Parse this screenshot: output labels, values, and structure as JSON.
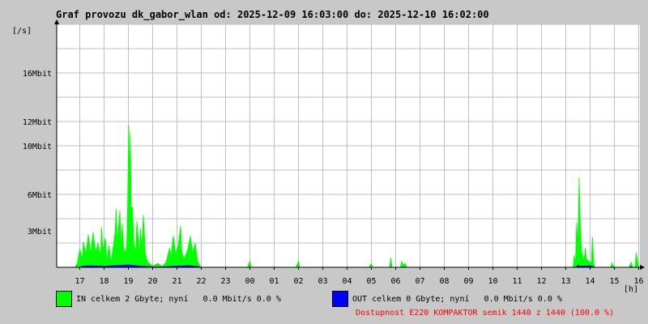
{
  "chart_data": {
    "type": "area",
    "title": "Graf provozu dk_gabor_wlan od: 2025-12-09 16:03:00 do: 2025-12-10 16:02:00",
    "ylabel": "[/s]",
    "xlabel": "[h]",
    "x_ticks": [
      "17",
      "18",
      "19",
      "20",
      "21",
      "22",
      "23",
      "00",
      "01",
      "02",
      "03",
      "04",
      "05",
      "06",
      "07",
      "08",
      "09",
      "10",
      "11",
      "12",
      "13",
      "14",
      "15",
      "16"
    ],
    "y_ticks": [
      {
        "value": 3,
        "label": "3Mbit"
      },
      {
        "value": 6,
        "label": "6Mbit"
      },
      {
        "value": 10,
        "label": "10Mbit"
      },
      {
        "value": 12,
        "label": "12Mbit"
      },
      {
        "value": 16,
        "label": "16Mbit"
      }
    ],
    "ylim": [
      0,
      20
    ],
    "xlim": [
      16.05,
      16.05
    ],
    "grid": true,
    "series": [
      {
        "name": "IN",
        "color": "#00ff00",
        "points": [
          [
            16.8,
            0
          ],
          [
            16.9,
            0.3
          ],
          [
            17.0,
            1.5
          ],
          [
            17.1,
            0.7
          ],
          [
            17.15,
            2.1
          ],
          [
            17.25,
            1.0
          ],
          [
            17.35,
            2.7
          ],
          [
            17.45,
            1.1
          ],
          [
            17.55,
            2.9
          ],
          [
            17.65,
            1.2
          ],
          [
            17.75,
            2.0
          ],
          [
            17.85,
            0.8
          ],
          [
            17.9,
            3.3
          ],
          [
            17.95,
            1.4
          ],
          [
            18.05,
            2.4
          ],
          [
            18.12,
            0.5
          ],
          [
            18.2,
            1.8
          ],
          [
            18.3,
            0.4
          ],
          [
            18.35,
            1.3
          ],
          [
            18.45,
            2.8
          ],
          [
            18.5,
            4.8
          ],
          [
            18.55,
            2.0
          ],
          [
            18.65,
            4.7
          ],
          [
            18.7,
            1.5
          ],
          [
            18.75,
            3.6
          ],
          [
            18.82,
            0.9
          ],
          [
            18.88,
            1.6
          ],
          [
            18.92,
            0.8
          ],
          [
            18.97,
            5.0
          ],
          [
            19.0,
            9.5
          ],
          [
            19.02,
            11.7
          ],
          [
            19.05,
            7.2
          ],
          [
            19.08,
            11.0
          ],
          [
            19.12,
            4.4
          ],
          [
            19.17,
            5.0
          ],
          [
            19.22,
            2.1
          ],
          [
            19.3,
            1.1
          ],
          [
            19.35,
            3.8
          ],
          [
            19.45,
            1.2
          ],
          [
            19.5,
            3.2
          ],
          [
            19.55,
            1.7
          ],
          [
            19.62,
            4.3
          ],
          [
            19.7,
            1.1
          ],
          [
            19.8,
            0.4
          ],
          [
            20.0,
            0.1
          ],
          [
            20.2,
            0.3
          ],
          [
            20.4,
            0.1
          ],
          [
            20.55,
            0.4
          ],
          [
            20.7,
            1.6
          ],
          [
            20.75,
            0.9
          ],
          [
            20.85,
            2.6
          ],
          [
            20.95,
            1.0
          ],
          [
            21.05,
            1.8
          ],
          [
            21.15,
            3.4
          ],
          [
            21.2,
            1.2
          ],
          [
            21.3,
            0.7
          ],
          [
            21.45,
            1.5
          ],
          [
            21.55,
            2.6
          ],
          [
            21.65,
            1.2
          ],
          [
            21.75,
            2.0
          ],
          [
            21.85,
            0.5
          ],
          [
            21.95,
            0.1
          ],
          [
            22.0,
            0
          ],
          [
            23.9,
            0
          ],
          [
            24.0,
            0.5
          ],
          [
            24.05,
            0
          ],
          [
            25.9,
            0
          ],
          [
            26.0,
            0.5
          ],
          [
            26.05,
            0
          ],
          [
            28.9,
            0
          ],
          [
            29.0,
            0.3
          ],
          [
            29.05,
            0
          ],
          [
            29.75,
            0
          ],
          [
            29.8,
            0.8
          ],
          [
            29.85,
            0
          ],
          [
            30.2,
            0
          ],
          [
            30.25,
            0.5
          ],
          [
            30.3,
            0.2
          ],
          [
            30.4,
            0.3
          ],
          [
            30.45,
            0
          ],
          [
            37.3,
            0
          ],
          [
            37.35,
            1.0
          ],
          [
            37.4,
            0.2
          ],
          [
            37.45,
            3.7
          ],
          [
            37.5,
            1.8
          ],
          [
            37.55,
            7.4
          ],
          [
            37.6,
            3.3
          ],
          [
            37.65,
            1.3
          ],
          [
            37.75,
            0.5
          ],
          [
            37.8,
            1.6
          ],
          [
            37.85,
            0.7
          ],
          [
            37.95,
            0.5
          ],
          [
            38.05,
            0.3
          ],
          [
            38.1,
            2.5
          ],
          [
            38.15,
            0.3
          ],
          [
            38.2,
            0
          ],
          [
            38.85,
            0
          ],
          [
            38.9,
            0.4
          ],
          [
            38.95,
            0.1
          ],
          [
            39.05,
            0
          ],
          [
            39.6,
            0
          ],
          [
            39.65,
            0.2
          ],
          [
            39.7,
            0.4
          ],
          [
            39.75,
            0
          ],
          [
            39.85,
            0
          ],
          [
            39.9,
            1.2
          ],
          [
            39.95,
            0.5
          ],
          [
            40.0,
            0
          ]
        ]
      },
      {
        "name": "OUT",
        "color": "#0000ff",
        "points": [
          [
            17.0,
            0
          ],
          [
            17.1,
            0.1
          ],
          [
            17.5,
            0.12
          ],
          [
            18.0,
            0.08
          ],
          [
            18.5,
            0.15
          ],
          [
            19.0,
            0.2
          ],
          [
            19.5,
            0.1
          ],
          [
            20.0,
            0.04
          ],
          [
            20.5,
            0.05
          ],
          [
            21.0,
            0.1
          ],
          [
            21.5,
            0.14
          ],
          [
            21.9,
            0.05
          ],
          [
            22.0,
            0
          ],
          [
            37.4,
            0
          ],
          [
            37.5,
            0.15
          ],
          [
            37.6,
            0.08
          ],
          [
            38.0,
            0.12
          ],
          [
            38.2,
            0
          ],
          [
            39.6,
            0
          ],
          [
            39.7,
            0.05
          ],
          [
            39.8,
            0
          ]
        ]
      }
    ]
  },
  "legend": {
    "in_text": "IN celkem 2 Gbyte; nyní   0.0 Mbit/s 0.0 %",
    "out_text": "OUT celkem 0 Gbyte; nyní   0.0 Mbit/s 0.0 %",
    "in_color": "#00ff00",
    "out_color": "#0000ff"
  },
  "availability": "Dostupnost E220 KOMPAKTOR semik 1440 z 1440 (100.0 %)"
}
